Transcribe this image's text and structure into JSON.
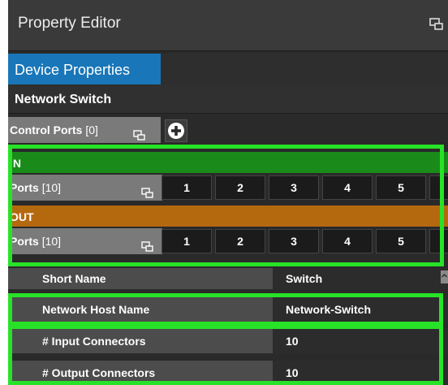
{
  "panel": {
    "title": "Property Editor",
    "tab_label": "Device Properties",
    "device_title": "Network Switch"
  },
  "control_ports": {
    "label": "Control Ports",
    "count": "[0]"
  },
  "inputs": {
    "header": "IN",
    "ports_label": "Ports",
    "ports_count": "[10]",
    "ports": [
      "1",
      "2",
      "3",
      "4",
      "5"
    ]
  },
  "outputs": {
    "header": "OUT",
    "ports_label": "Ports",
    "ports_count": "[10]",
    "ports": [
      "1",
      "2",
      "3",
      "4",
      "5"
    ]
  },
  "properties": {
    "short_name_label": "Short Name",
    "short_name_value": "Switch",
    "host_name_label": "Network Host Name",
    "host_name_value": "Network-Switch",
    "input_connectors_label": "# Input Connectors",
    "input_connectors_value": "10",
    "output_connectors_label": "# Output Connectors",
    "output_connectors_value": "10"
  },
  "icons": {
    "float": "window-float-icon",
    "add": "plus-circle-icon",
    "scroll": "scroll-up-icon"
  },
  "colors": {
    "highlight": "#27e227",
    "in_header": "#1a8b1a",
    "out_header": "#b5690f",
    "tab_active": "#1976b8"
  }
}
